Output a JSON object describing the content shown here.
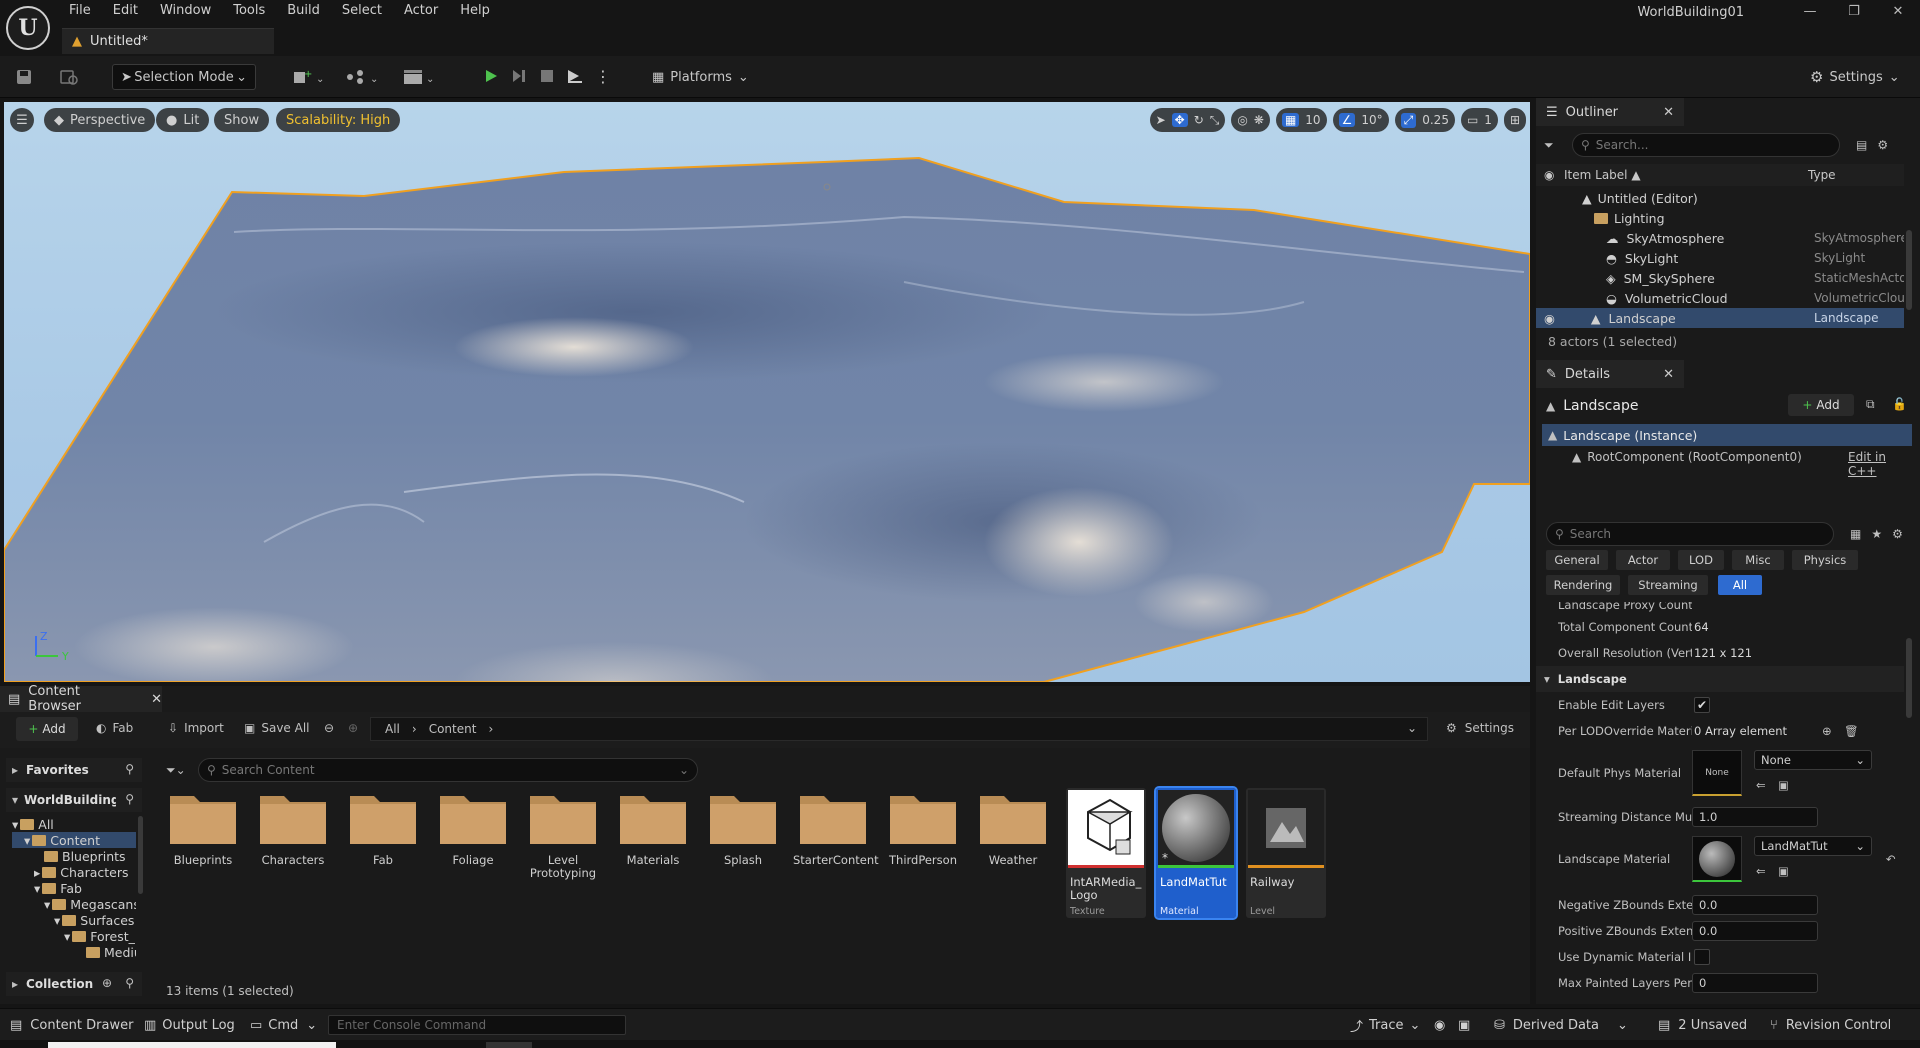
{
  "menubar": {
    "items": [
      "File",
      "Edit",
      "Window",
      "Tools",
      "Build",
      "Select",
      "Actor",
      "Help"
    ],
    "project_name": "WorldBuilding01",
    "doc_tab": "Untitled*"
  },
  "toolbar": {
    "selection_mode": "Selection Mode",
    "platforms": "Platforms",
    "settings": "Settings"
  },
  "viewport": {
    "perspective": "Perspective",
    "lit": "Lit",
    "show": "Show",
    "scalability": "Scalability: High",
    "grid_snap": "10",
    "rotation_snap": "10°",
    "scale_snap": "0.25",
    "camera_speed": "1",
    "axis_z": "Z",
    "axis_y": "Y"
  },
  "outliner": {
    "title": "Outliner",
    "search_placeholder": "Search...",
    "col_label": "Item Label ▲",
    "col_type": "Type",
    "rows": [
      {
        "label": "Untitled (Editor)",
        "type": ""
      },
      {
        "label": "Lighting",
        "type": ""
      },
      {
        "label": "SkyAtmosphere",
        "type": "SkyAtmosphere"
      },
      {
        "label": "SkyLight",
        "type": "SkyLight"
      },
      {
        "label": "SM_SkySphere",
        "type": "StaticMeshActo"
      },
      {
        "label": "VolumetricCloud",
        "type": "VolumetricCloud"
      },
      {
        "label": "Landscape",
        "type": "Landscape"
      }
    ],
    "status": "8 actors (1 selected)"
  },
  "details": {
    "title": "Details",
    "actor_name": "Landscape",
    "add_label": "Add",
    "instance": "Landscape (Instance)",
    "root_component": "RootComponent (RootComponent0)",
    "edit_cpp": "Edit in C++",
    "search_placeholder": "Search",
    "filters": [
      "General",
      "Actor",
      "LOD",
      "Misc",
      "Physics",
      "Rendering",
      "Streaming",
      "All"
    ],
    "props": {
      "proxy_count_label": "Landscape Proxy Count",
      "total_component_label": "Total Component Count",
      "total_component_value": "64",
      "resolution_label": "Overall Resolution (Verts)",
      "resolution_value": "121 x 121",
      "section_landscape": "Landscape",
      "enable_edit_layers": "Enable Edit Layers",
      "per_lod_label": "Per LODOverride Materials",
      "per_lod_value": "0 Array element",
      "phys_material_label": "Default Phys Material",
      "phys_material_thumb": "None",
      "phys_material_value": "None",
      "streaming_label": "Streaming Distance Multiplier",
      "streaming_value": "1.0",
      "material_label": "Landscape Material",
      "material_value": "LandMatTut",
      "neg_z_label": "Negative ZBounds Extent",
      "neg_z_value": "0.0",
      "pos_z_label": "Positive ZBounds Extent",
      "pos_z_value": "0.0",
      "dyn_material_label": "Use Dynamic Material Instance",
      "max_layers_label": "Max Painted Layers Per Component",
      "max_layers_value": "0"
    }
  },
  "content_browser": {
    "tab": "Content Browser",
    "add": "Add",
    "fab": "Fab",
    "import": "Import",
    "save_all": "Save All",
    "path": [
      "All",
      "Content"
    ],
    "settings": "Settings",
    "favorites": "Favorites",
    "project": "WorldBuildingC",
    "tree": [
      "All",
      "Content",
      "Blueprints",
      "Characters",
      "Fab",
      "Megascans",
      "Surfaces",
      "Forest_",
      "Mediu"
    ],
    "collections": "Collection",
    "search_placeholder": "Search Content",
    "folders": [
      "Blueprints",
      "Characters",
      "Fab",
      "Foliage",
      "Level Prototyping",
      "Materials",
      "Splash",
      "StarterContent",
      "ThirdPerson",
      "Weather"
    ],
    "assets": [
      {
        "name": "IntARMedia_ Logo",
        "kind": "Texture"
      },
      {
        "name": "LandMatTut",
        "kind": "Material"
      },
      {
        "name": "Railway",
        "kind": "Level"
      }
    ],
    "status": "13 items (1 selected)"
  },
  "statusbar": {
    "content_drawer": "Content Drawer",
    "output_log": "Output Log",
    "cmd": "Cmd",
    "console_placeholder": "Enter Console Command",
    "trace": "Trace",
    "derived_data": "Derived Data",
    "unsaved": "2 Unsaved",
    "revision_control": "Revision Control"
  },
  "colors": {
    "accent": "#2e6bd0",
    "selection_outline": "#f0a020",
    "scalability": "#f0c030"
  }
}
